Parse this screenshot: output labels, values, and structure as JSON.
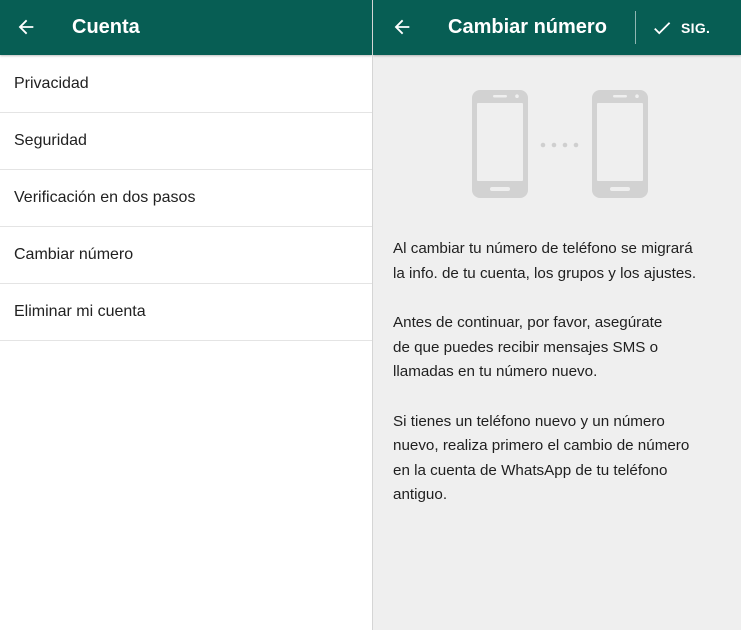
{
  "left_screen": {
    "title": "Cuenta",
    "menu_items": [
      {
        "label": "Privacidad"
      },
      {
        "label": "Seguridad"
      },
      {
        "label": "Verificación en dos pasos"
      },
      {
        "label": "Cambiar número"
      },
      {
        "label": "Eliminar mi cuenta"
      }
    ]
  },
  "right_screen": {
    "title": "Cambiar número",
    "next_label": "SIG.",
    "paragraphs": [
      "Al cambiar tu número de teléfono se migrará\nla info. de tu cuenta, los grupos y los ajustes.",
      "Antes de continuar, por favor, asegúrate\nde que puedes recibir mensajes SMS o\nllamadas en tu número nuevo.",
      "Si tienes un teléfono nuevo y un número\nnuevo, realiza primero el cambio de número\nen la cuenta de WhatsApp de tu teléfono\nantiguo."
    ]
  },
  "colors": {
    "appbar": "#075e54",
    "right_background": "#efefef",
    "phone_illustration": "#d2d2d2"
  },
  "icons": {
    "back": "arrow-back-icon",
    "confirm": "checkmark-icon",
    "phones": "phone-illustration-icon",
    "dots": "transfer-dots-icon"
  }
}
